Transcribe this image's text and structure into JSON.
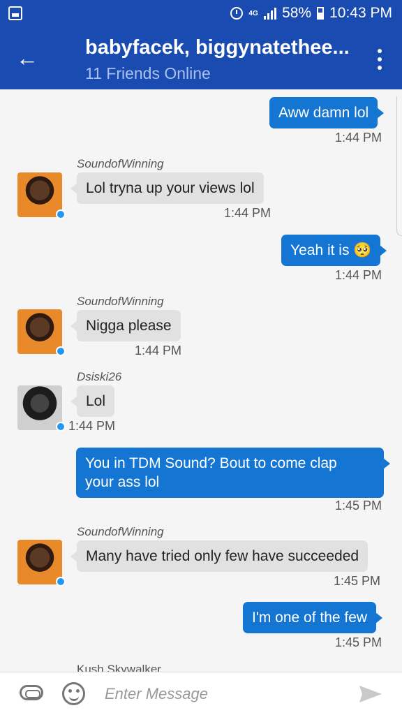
{
  "status_bar": {
    "battery": "58%",
    "time": "10:43 PM",
    "data_label": "4G"
  },
  "header": {
    "title": "babyfacek, biggynatethee...",
    "subtitle": "11 Friends Online"
  },
  "messages": [
    {
      "type": "outgoing",
      "text": "Aww damn lol",
      "time": "1:44 PM"
    },
    {
      "type": "incoming",
      "sender": "SoundofWinning",
      "text": "Lol tryna up your views lol",
      "time": "1:44 PM"
    },
    {
      "type": "outgoing",
      "text": "Yeah it is 🥺",
      "time": "1:44 PM"
    },
    {
      "type": "incoming",
      "sender": "SoundofWinning",
      "text": "Nigga please",
      "time": "1:44 PM"
    },
    {
      "type": "incoming",
      "sender": "Dsiski26",
      "text": "Lol",
      "time": "1:44 PM"
    },
    {
      "type": "outgoing",
      "text_line1": "You in TDM Sound? Bout to come clap",
      "text_line2": "your ass lol",
      "time": "1:45 PM"
    },
    {
      "type": "incoming",
      "sender": "SoundofWinning",
      "text": "Many have tried only few have succeeded",
      "time": "1:45 PM"
    },
    {
      "type": "outgoing",
      "text": "I'm one of the few",
      "time": "1:45 PM"
    },
    {
      "type": "incoming",
      "sender": "Kush Skywalker"
    }
  ],
  "composer": {
    "placeholder": "Enter Message"
  },
  "colors": {
    "header": "#1a4bb0",
    "outgoing_bubble": "#1476d2",
    "incoming_bubble": "#e1e1e1",
    "online_dot": "#2196f3"
  },
  "icons": [
    "gallery-icon",
    "alarm-icon",
    "data-icon",
    "signal-icon",
    "battery-icon",
    "back-arrow-icon",
    "overflow-menu-icon",
    "attach-icon",
    "emoji-icon",
    "send-icon"
  ]
}
